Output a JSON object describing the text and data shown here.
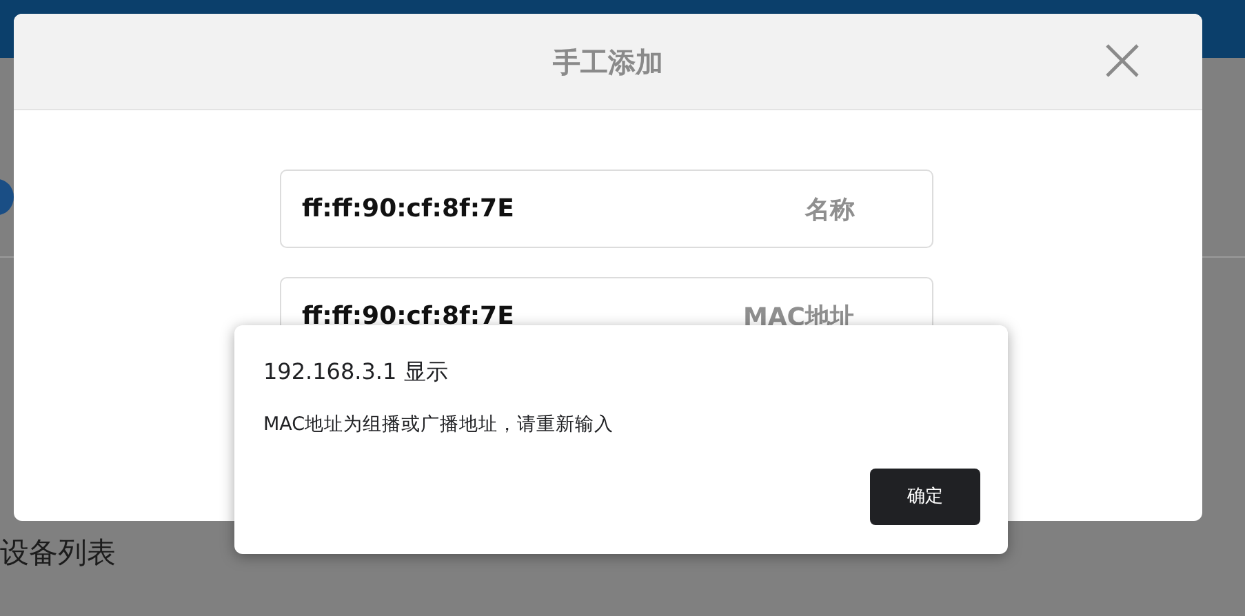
{
  "background_page": {
    "section_title": "设备列表"
  },
  "dialog": {
    "title": "手工添加",
    "fields": [
      {
        "value": "ff:ff:90:cf:8f:7E",
        "label": "名称"
      },
      {
        "value": "ff:ff:90:cf:8f:7E",
        "label": "MAC地址"
      }
    ]
  },
  "alert": {
    "title": "192.168.3.1 显示",
    "message": "MAC地址为组播或广播地址，请重新输入",
    "button": "确定"
  }
}
